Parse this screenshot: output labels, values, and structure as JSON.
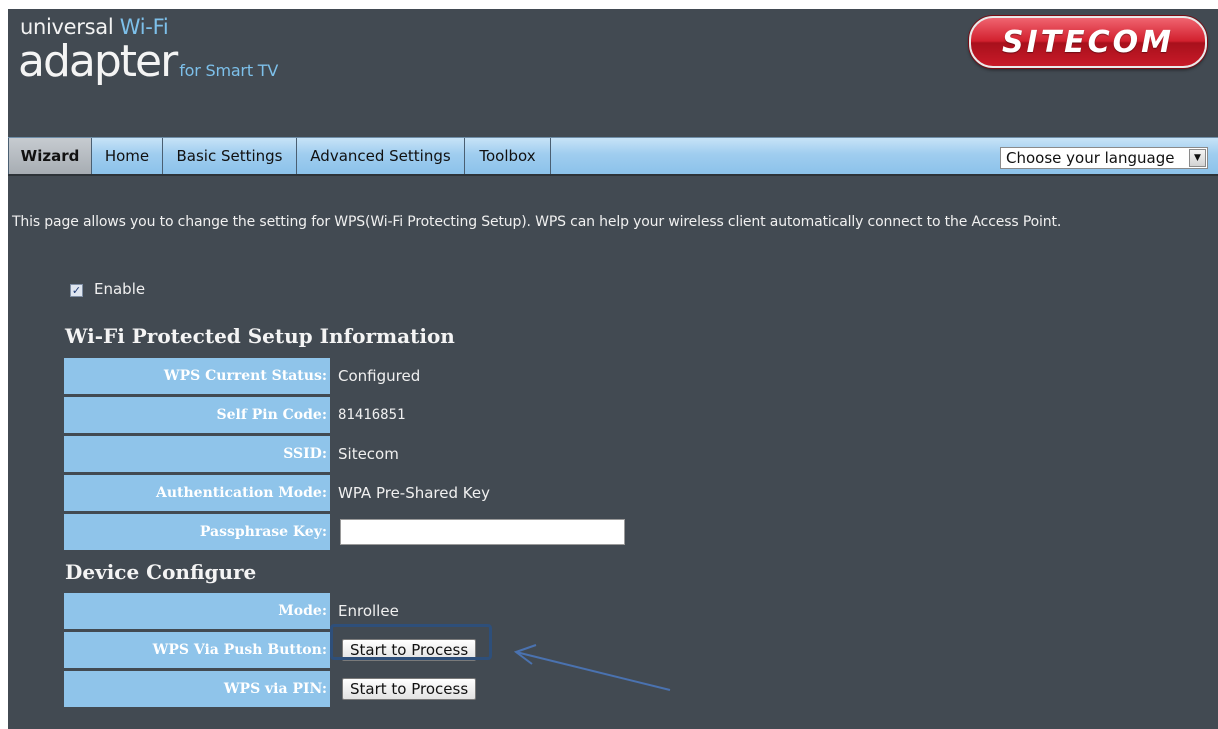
{
  "header": {
    "logo_line1_a": "universal ",
    "logo_line1_b": "Wi-Fi",
    "logo_main": "adapter",
    "logo_sub": "for Smart TV",
    "brand": "SITECOM"
  },
  "nav": {
    "tabs": [
      {
        "label": "Wizard",
        "active": true
      },
      {
        "label": "Home"
      },
      {
        "label": "Basic Settings"
      },
      {
        "label": "Advanced Settings"
      },
      {
        "label": "Toolbox"
      }
    ],
    "language_select": "Choose your language"
  },
  "intro_text": "This page allows you to change the setting for WPS(Wi-Fi Protecting Setup). WPS can help your wireless client automatically connect to the Access Point.",
  "enable": {
    "label": "Enable",
    "checked": true
  },
  "wps_info": {
    "title": "Wi-Fi Protected Setup Information",
    "rows": [
      {
        "label": "WPS Current Status:",
        "value": "Configured"
      },
      {
        "label": "Self Pin Code:",
        "value": "81416851"
      },
      {
        "label": "SSID:",
        "value": "Sitecom"
      },
      {
        "label": "Authentication Mode:",
        "value": "WPA Pre-Shared Key"
      },
      {
        "label": "Passphrase Key:",
        "value": ""
      }
    ]
  },
  "device_configure": {
    "title": "Device Configure",
    "mode_label": "Mode:",
    "mode_value": "Enrollee",
    "push_button_label": "WPS Via Push Button:",
    "push_button_btn": "Start to Process",
    "pin_label": "WPS via PIN:",
    "pin_btn": "Start to Process"
  },
  "colors": {
    "background": "#424a52",
    "label_cell": "#8fc4ea",
    "nav_bar": "#9fcdef",
    "brand_red": "#d2202e",
    "annotation": "#4a72b0"
  }
}
